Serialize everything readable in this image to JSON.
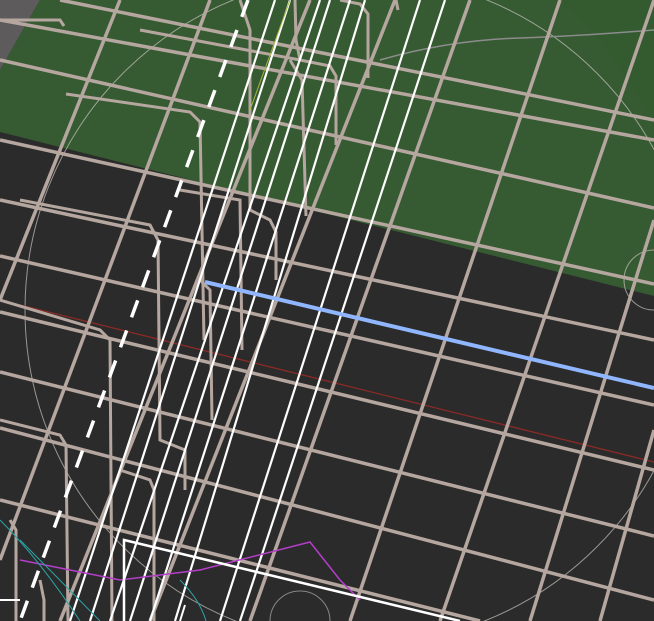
{
  "viewport": {
    "name": "map-canvas",
    "background_color": "#2b2b2b",
    "green_area_color": "#365a31",
    "grey_area_color": "#5d5b5b"
  },
  "layers": {
    "ground_green": "green-field",
    "ground_grey": "grey-ground",
    "grid_color": "#b5a79f",
    "white_lines_color": "#ffffff",
    "blue_highlight_color": "#8fb6ff",
    "red_line_color": "#8a2a26",
    "circle_color": "#c9c4c0",
    "magenta_color": "#b43ec9",
    "cyan_color": "#2aa3a6"
  },
  "icons": {
    "selection-outline": "rectangle-outline-icon"
  }
}
